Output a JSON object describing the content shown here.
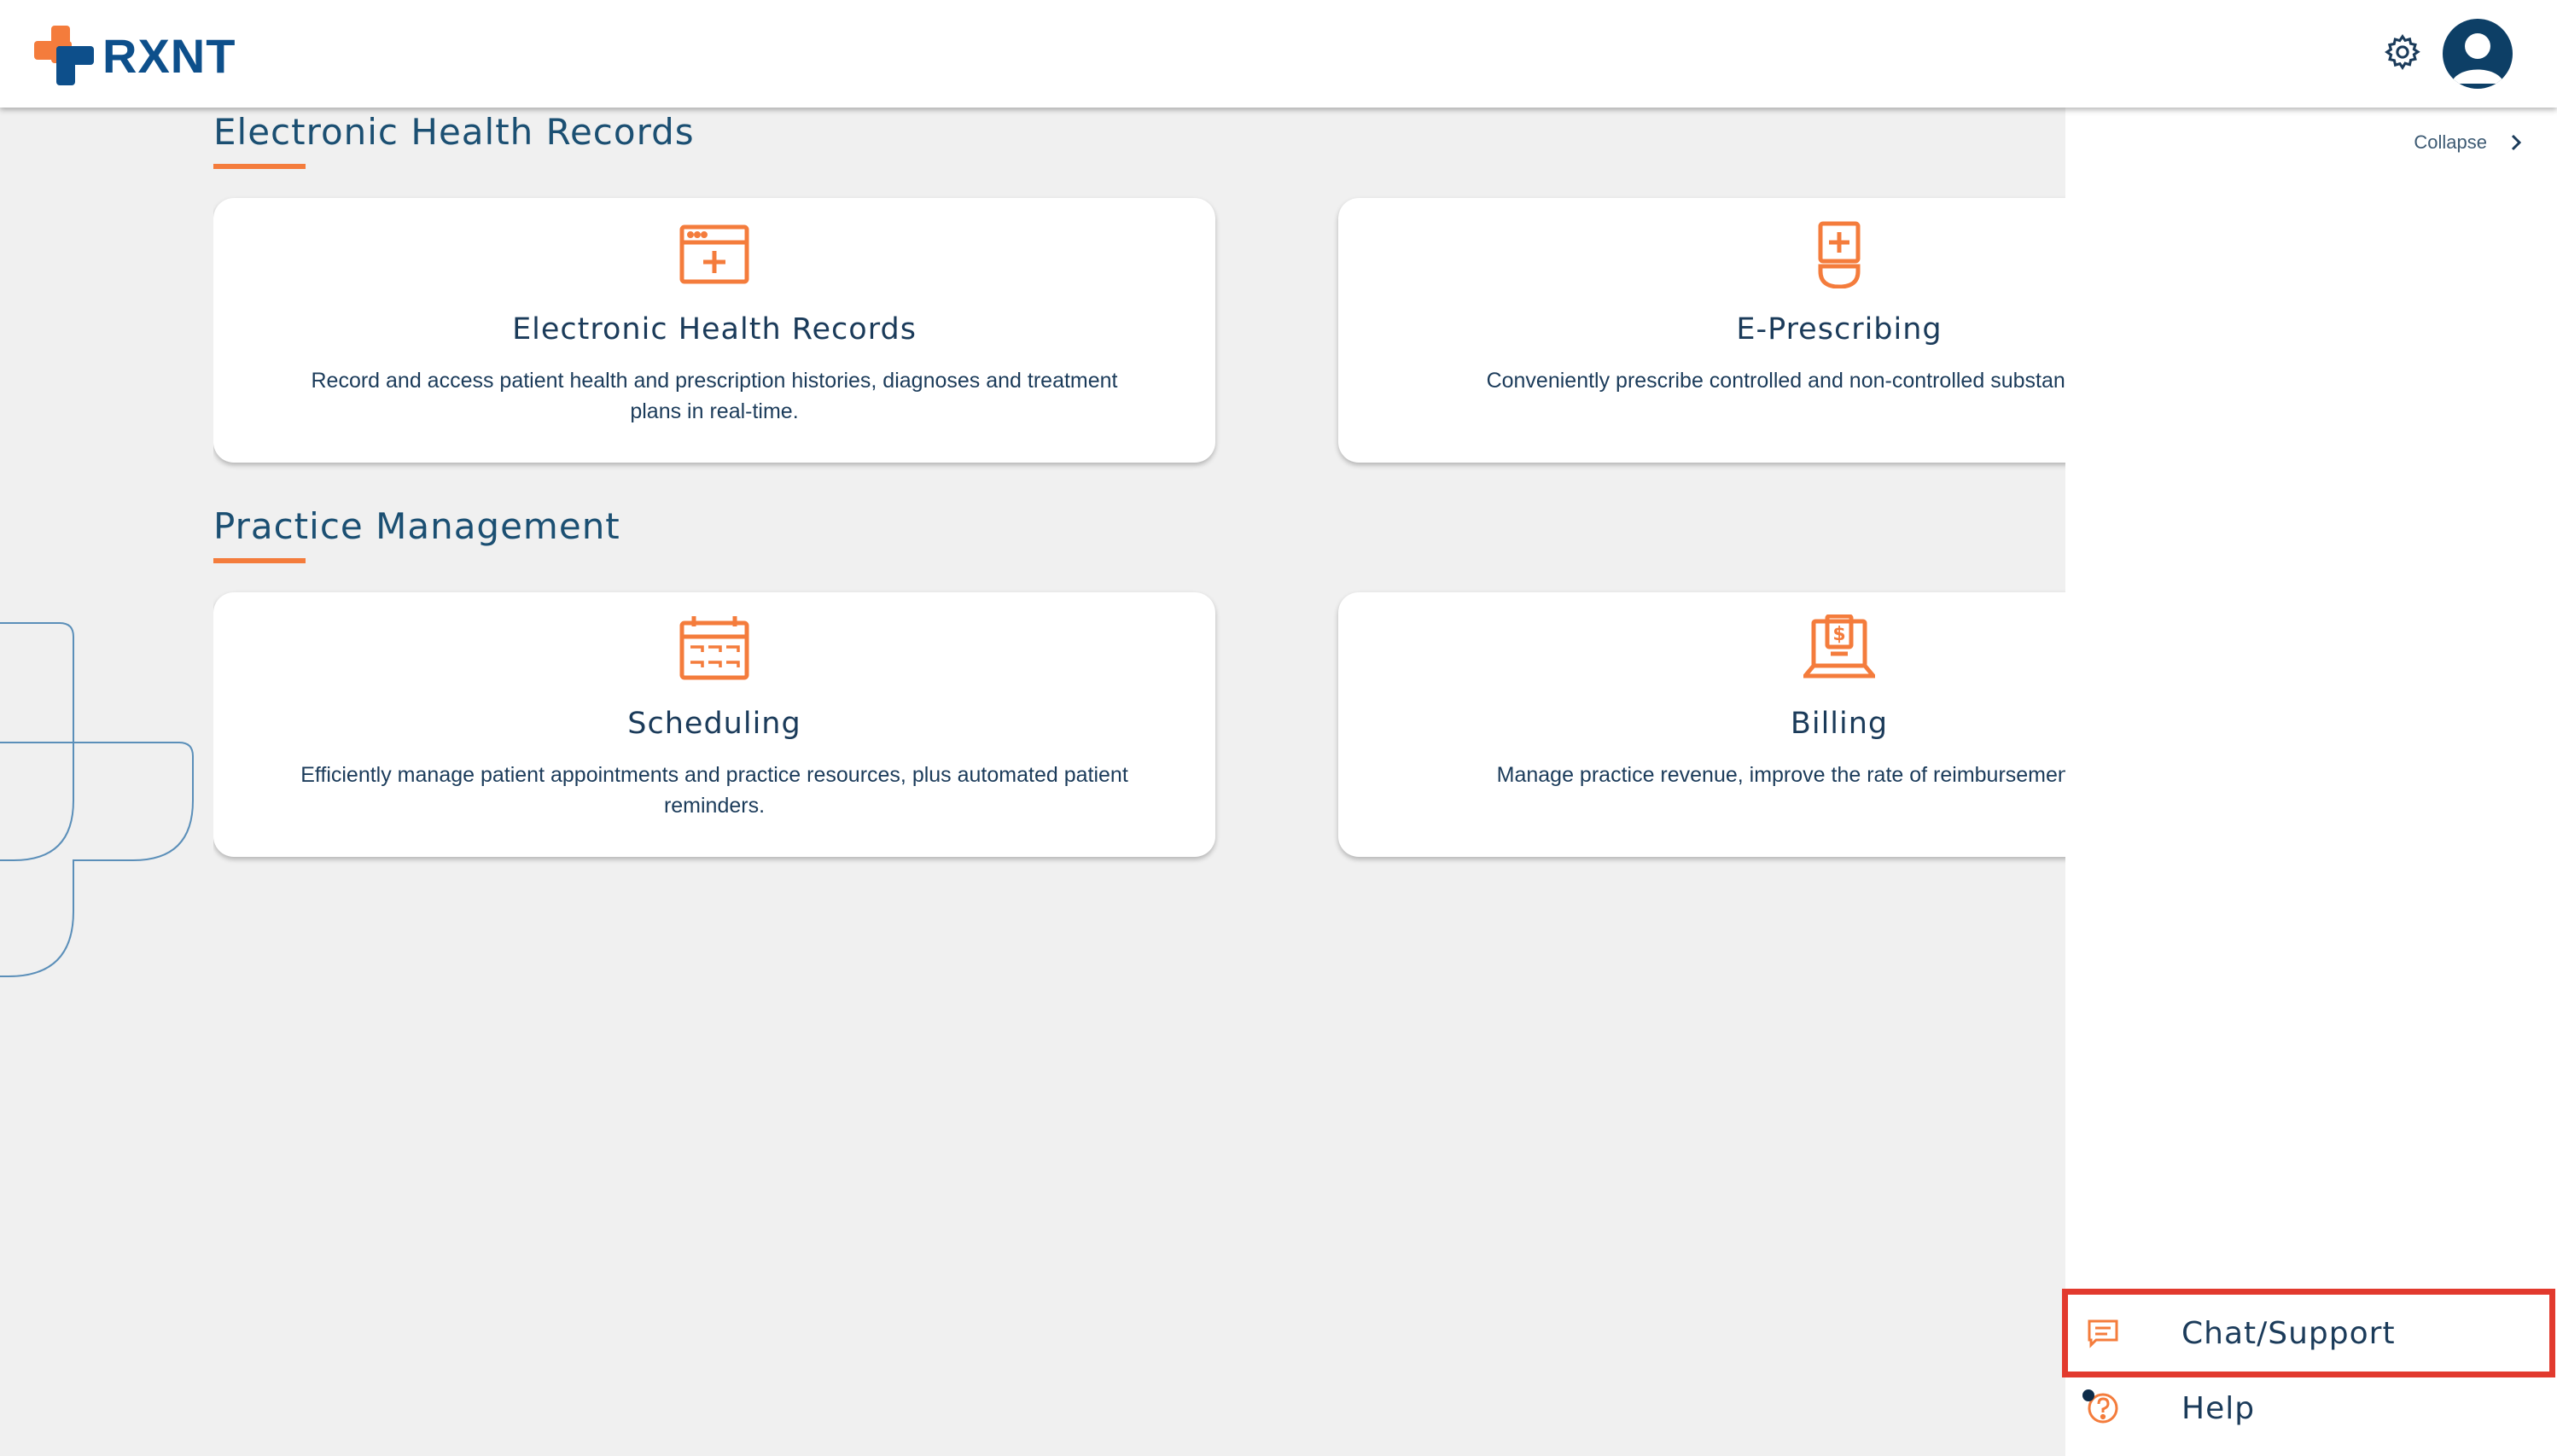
{
  "header": {
    "logo_text": "RXNT",
    "settings_icon": "gear-icon",
    "avatar_icon": "user-avatar-icon"
  },
  "colors": {
    "brand_blue": "#0d4f8b",
    "accent_orange": "#f47c3c",
    "text_navy": "#1b3b5a",
    "highlight_red": "#e23a2e"
  },
  "sections": [
    {
      "title": "Electronic Health Records",
      "cards": [
        {
          "icon": "ehr-window-medical-icon",
          "title": "Electronic Health Records",
          "description": "Record and access patient health and prescription histories, diagnoses and treatment plans in real-time."
        },
        {
          "icon": "prescription-bottle-icon",
          "title": "E-Prescribing",
          "description": "Conveniently prescribe controlled and non-controlled substanc at any time."
        }
      ]
    },
    {
      "title": "Practice Management",
      "cards": [
        {
          "icon": "calendar-icon",
          "title": "Scheduling",
          "description": "Efficiently manage patient appointments and practice resources, plus automated patient reminders."
        },
        {
          "icon": "billing-laptop-dollar-icon",
          "title": "Billing",
          "description": "Manage practice revenue, improve the rate of reimbursemen profitability."
        }
      ]
    }
  ],
  "right_panel": {
    "collapse_label": "Collapse",
    "items": [
      {
        "label": "Chat/Support",
        "icon": "chat-bubble-icon"
      },
      {
        "label": "Help",
        "icon": "help-question-icon"
      }
    ]
  }
}
